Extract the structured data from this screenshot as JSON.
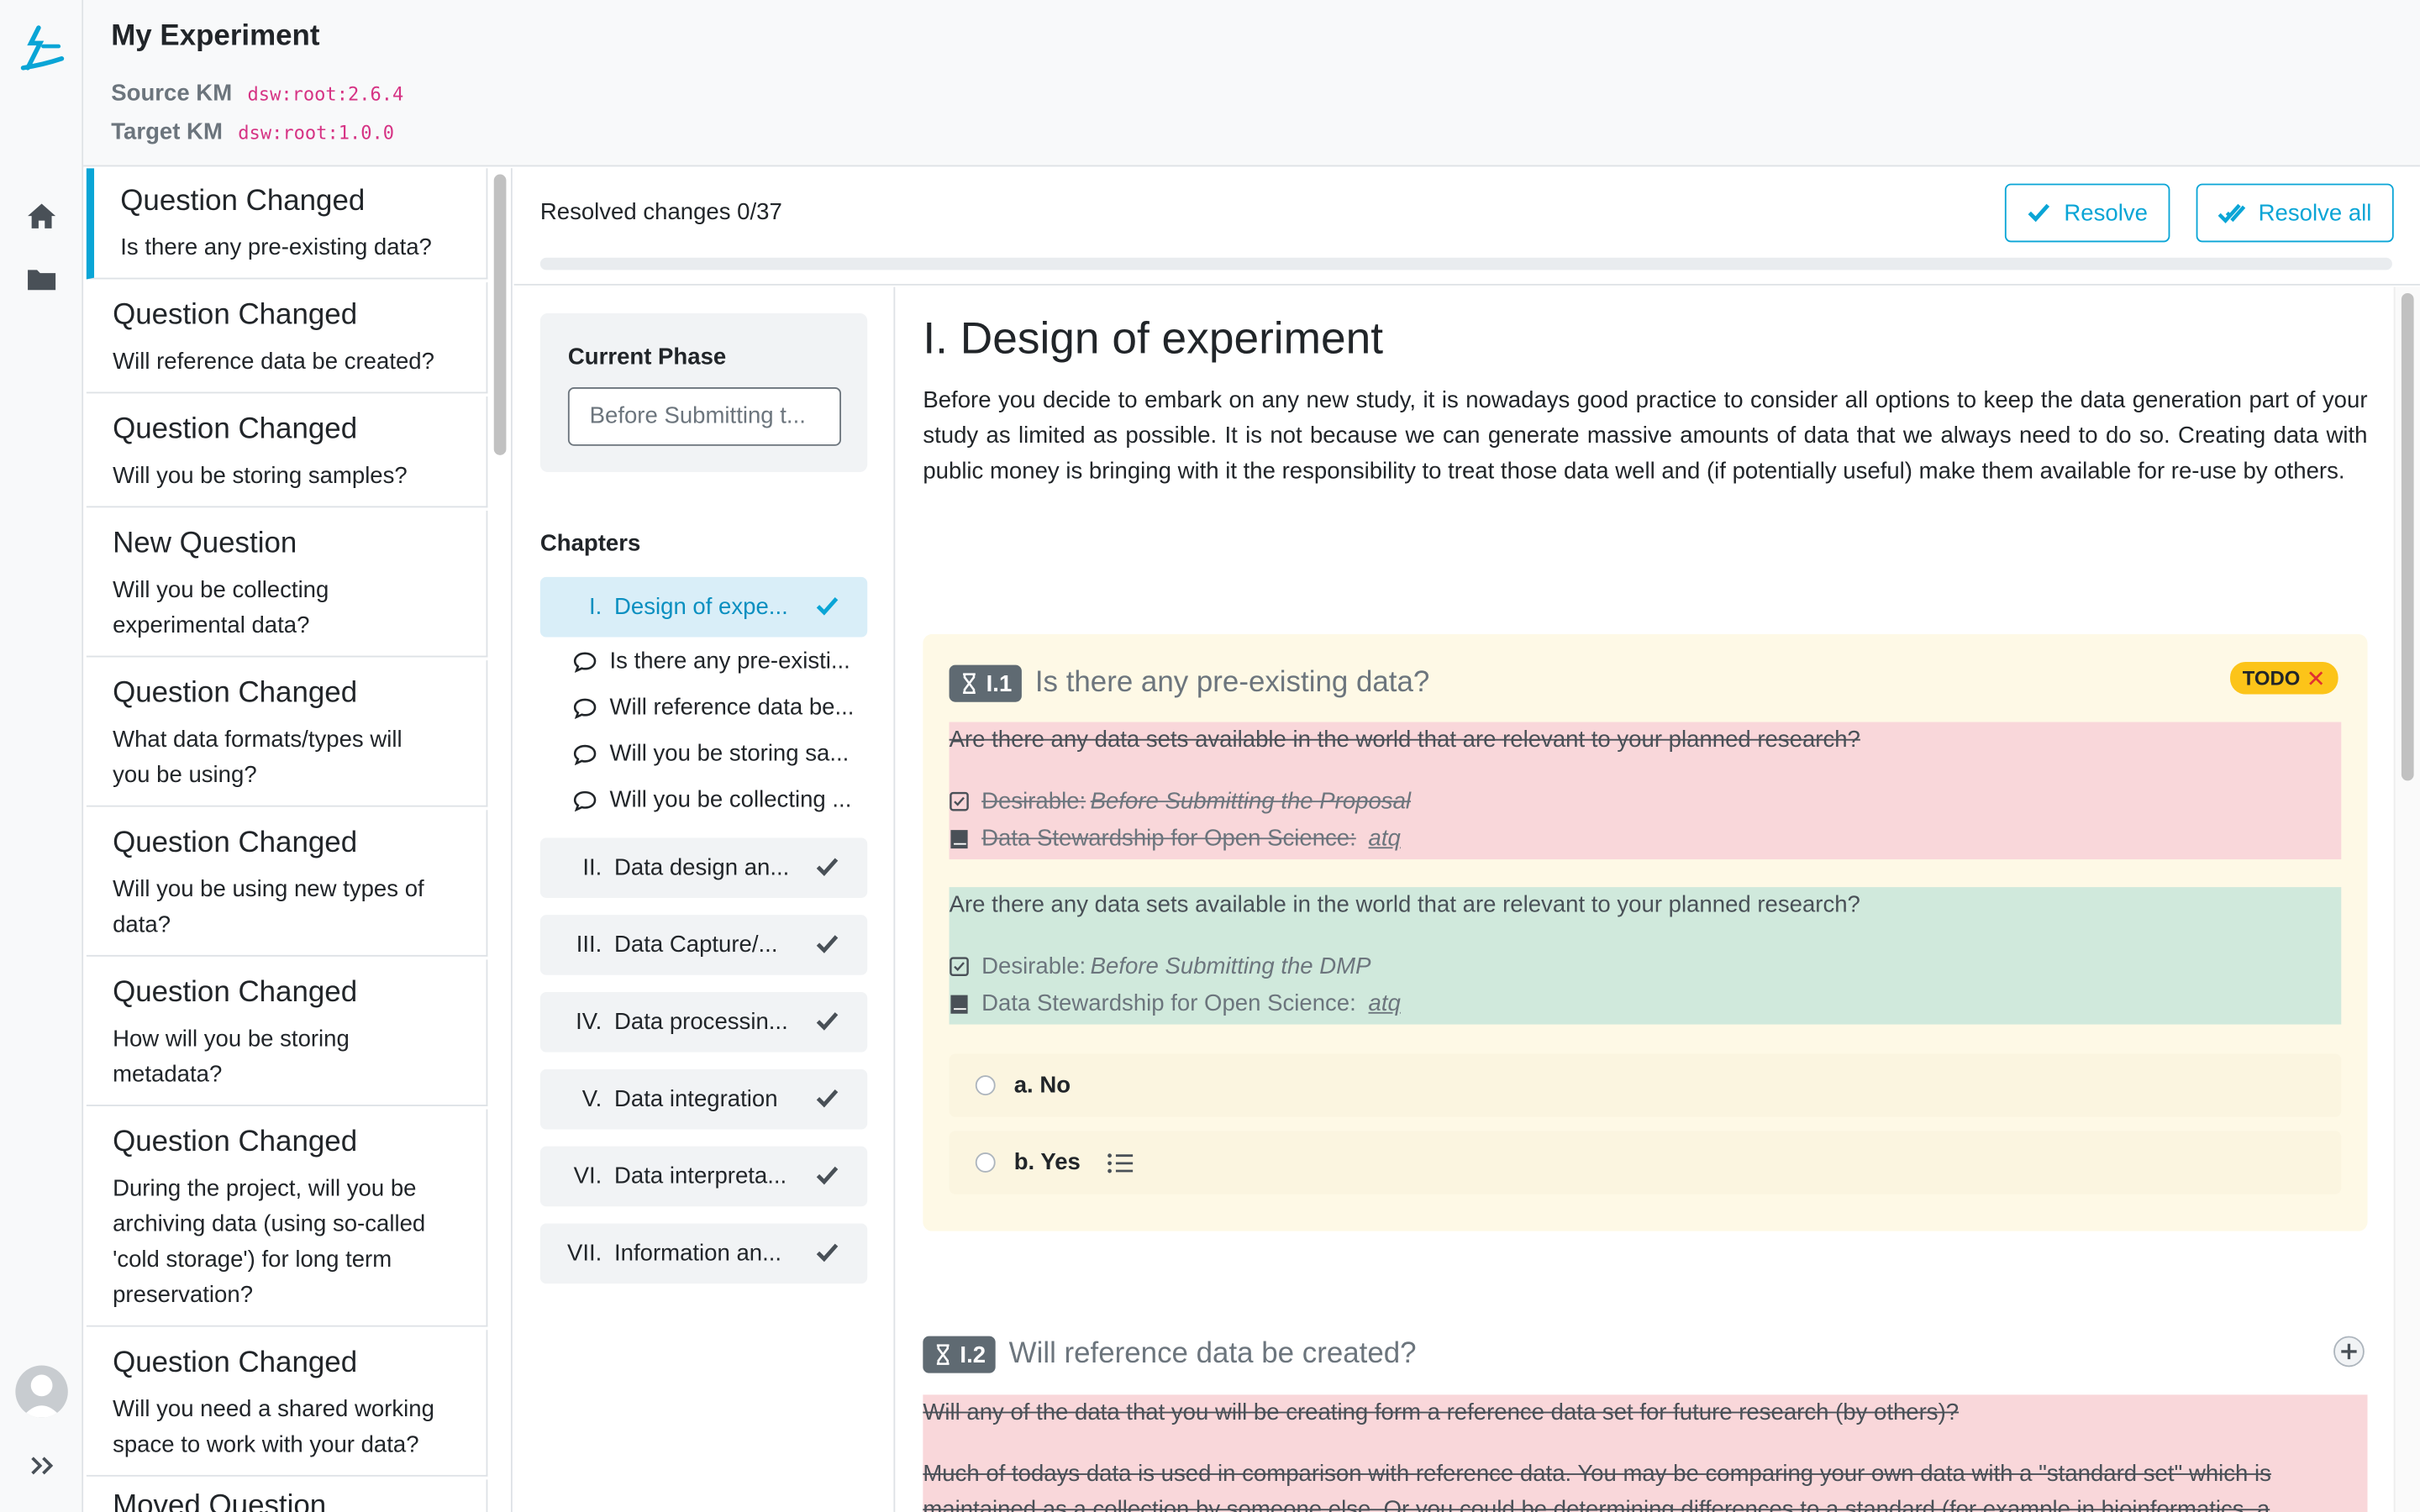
{
  "header": {
    "title": "My Experiment",
    "source_label": "Source KM",
    "source_value": "dsw:root:2.6.4",
    "target_label": "Target KM",
    "target_value": "dsw:root:1.0.0"
  },
  "changes": [
    {
      "type": "Question Changed",
      "question": "Is there any pre-existing data?"
    },
    {
      "type": "Question Changed",
      "question": "Will reference data be created?"
    },
    {
      "type": "Question Changed",
      "question": "Will you be storing samples?"
    },
    {
      "type": "New Question",
      "question": "Will you be collecting experimental data?"
    },
    {
      "type": "Question Changed",
      "question": "What data formats/types will you be using?"
    },
    {
      "type": "Question Changed",
      "question": "Will you be using new types of data?"
    },
    {
      "type": "Question Changed",
      "question": "How will you be storing metadata?"
    },
    {
      "type": "Question Changed",
      "question": "During the project, will you be archiving data (using so-called 'cold storage') for long term preservation?"
    },
    {
      "type": "Question Changed",
      "question": "Will you need a shared working space to work with your data?"
    },
    {
      "type": "Moved Question",
      "question": ""
    }
  ],
  "toolbar": {
    "resolved": "Resolved changes 0/37",
    "resolved_progress": 0,
    "resolve": "Resolve",
    "resolve_all": "Resolve all"
  },
  "phase": {
    "label": "Current Phase",
    "value": "Before Submitting t..."
  },
  "chapters": {
    "title": "Chapters",
    "items": [
      {
        "num": "I.",
        "name": "Design of expe..."
      },
      {
        "num": "II.",
        "name": "Data design an..."
      },
      {
        "num": "III.",
        "name": "Data Capture/..."
      },
      {
        "num": "IV.",
        "name": "Data processin..."
      },
      {
        "num": "V.",
        "name": "Data integration"
      },
      {
        "num": "VI.",
        "name": "Data interpreta..."
      },
      {
        "num": "VII.",
        "name": "Information an..."
      }
    ],
    "questions": [
      "Is there any pre-existi...",
      "Will reference data be...",
      "Will you be storing sa...",
      "Will you be collecting ..."
    ]
  },
  "content": {
    "heading": "I. Design of experiment",
    "intro": "Before you decide to embark on any new study, it is nowadays good practice to consider all options to keep the data generation part of your study as limited as possible. It is not because we can generate massive amounts of data that we always need to do so. Creating data with public money is bringing with it the responsibility to treat those data well and (if potentially useful) make them available for re-use by others.",
    "q1": {
      "badge": "I.1",
      "title": "Is there any pre-existing data?",
      "todo": "TODO",
      "old_text": "Are there any data sets available in the world that are relevant to your planned research?",
      "old_desirable_label": "Desirable:",
      "old_desirable_value": "Before Submitting the Proposal",
      "old_book_label": "Data Stewardship for Open Science:",
      "old_book_value": "atq",
      "new_text": "Are there any data sets available in the world that are relevant to your planned research?",
      "new_desirable_label": "Desirable:",
      "new_desirable_value": "Before Submitting the DMP",
      "new_book_label": "Data Stewardship for Open Science:",
      "new_book_value": "atq",
      "answers": [
        "a. No",
        "b. Yes"
      ]
    },
    "q2": {
      "badge": "I.2",
      "title": "Will reference data be created?",
      "old_text": "Will any of the data that you will be creating form a reference data set for future research (by others)?",
      "old_text2": "Much of todays data is used in comparison with reference data. You may be comparing your own data with a \"standard set\" which is",
      "old_text3": "maintained as a collection by someone else. Or you could be determining differences to a standard (for example in bioinformatics, a"
    }
  },
  "colors": {
    "accent": "#0aa5d6",
    "deleted_bg": "#f9d7da",
    "added_bg": "#d0e9dc",
    "question_bg": "#fef9e6",
    "todo_bg": "#fcc419"
  }
}
